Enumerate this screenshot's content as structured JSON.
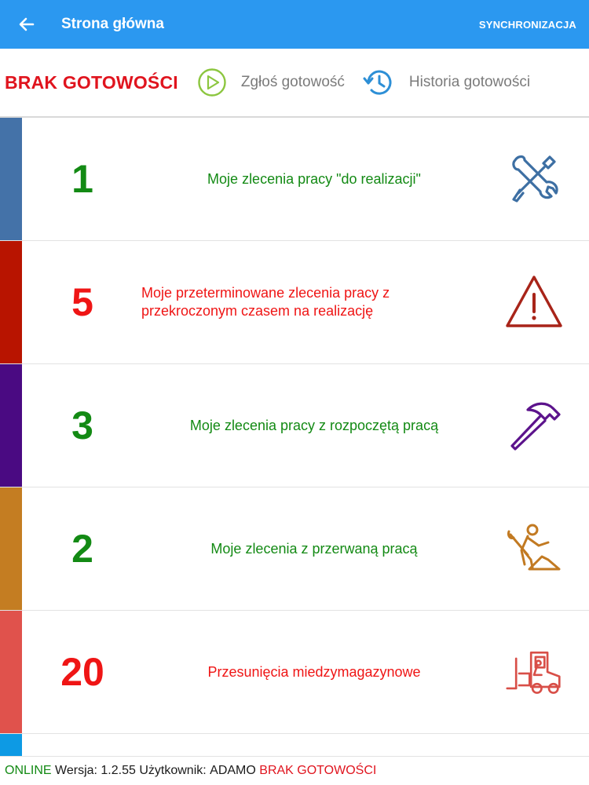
{
  "header": {
    "title": "Strona główna",
    "sync_label": "SYNCHRONIZACJA"
  },
  "readiness": {
    "status": "BRAK GOTOWOŚCI",
    "report_label": "Zgłoś gotowość",
    "history_label": "Historia gotowości"
  },
  "tiles": [
    {
      "count": "1",
      "label": "Moje zlecenia pracy \"do realizacji\"",
      "stripe_color": "#4472a8",
      "icon": "wrench-screwdriver-icon",
      "icon_color": "#3d6fa3"
    },
    {
      "count": "5",
      "label": "Moje przeterminowane zlecenia pracy z przekroczonym czasem na realizację",
      "stripe_color": "#b81400",
      "icon": "warning-triangle-icon",
      "icon_color": "#a82419"
    },
    {
      "count": "3",
      "label": "Moje zlecenia pracy z rozpoczętą pracą",
      "stripe_color": "#4a0a82",
      "icon": "hammer-icon",
      "icon_color": "#5c138c"
    },
    {
      "count": "2",
      "label": "Moje zlecenia z przerwaną pracą",
      "stripe_color": "#c47d22",
      "icon": "worker-digging-icon",
      "icon_color": "#c27a22"
    },
    {
      "count": "20",
      "label": "Przesunięcia miedzymagazynowe",
      "stripe_color": "#e0524c",
      "icon": "forklift-icon",
      "icon_color": "#d84f48"
    }
  ],
  "footer": {
    "online": "ONLINE",
    "version_label": " Wersja: ",
    "version": "1.2.55",
    "user_label": " Użytkownik: ",
    "user": "ADAMO",
    "status": "BRAK GOTOWOŚCI"
  },
  "colors": {
    "appbar": "#2b98f0",
    "accent_red": "#e0141e",
    "accent_green": "#138a14"
  }
}
